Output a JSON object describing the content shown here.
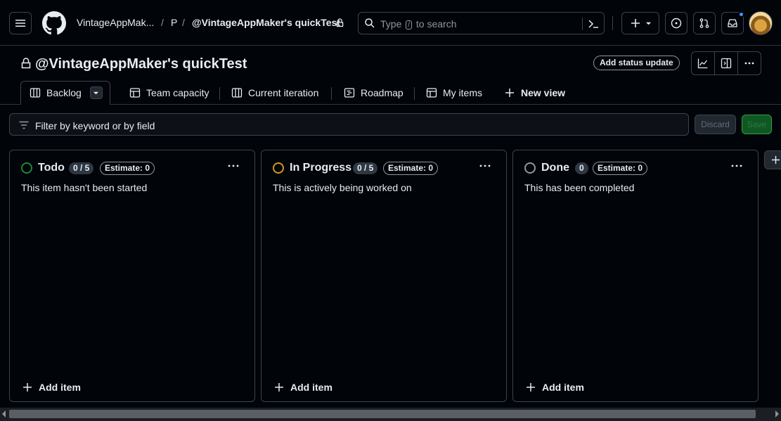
{
  "topbar": {
    "breadcrumb": {
      "owner": "VintageAppMak...",
      "separator": "/",
      "section": "P",
      "project": "@VintageAppMaker's quickTest"
    },
    "search": {
      "prefix": "Type",
      "key": "/",
      "suffix": "to search"
    }
  },
  "project": {
    "title": "@VintageAppMaker's quickTest",
    "status_button": "Add status update"
  },
  "tabs": [
    {
      "label": "Backlog"
    },
    {
      "label": "Team capacity"
    },
    {
      "label": "Current iteration"
    },
    {
      "label": "Roadmap"
    },
    {
      "label": "My items"
    },
    {
      "label": "New view"
    }
  ],
  "filter": {
    "placeholder": "Filter by keyword or by field",
    "discard": "Discard",
    "save": "Save"
  },
  "columns": [
    {
      "name": "Todo",
      "count": "0 / 5",
      "estimate": "Estimate: 0",
      "description": "This item hasn't been started",
      "add_label": "Add item",
      "color": "#238636"
    },
    {
      "name": "In Progress",
      "count": "0 / 5",
      "estimate": "Estimate: 0",
      "description": "This is actively being worked on",
      "add_label": "Add item",
      "color": "#d29922"
    },
    {
      "name": "Done",
      "count": "0",
      "estimate": "Estimate: 0",
      "description": "This has been completed",
      "add_label": "Add item",
      "color": "#9198a1"
    }
  ],
  "colors": {
    "background": "#010409",
    "border": "#3d444d",
    "text": "#e6edf3",
    "muted": "#9198a1",
    "accent_blue": "#4493f8"
  }
}
